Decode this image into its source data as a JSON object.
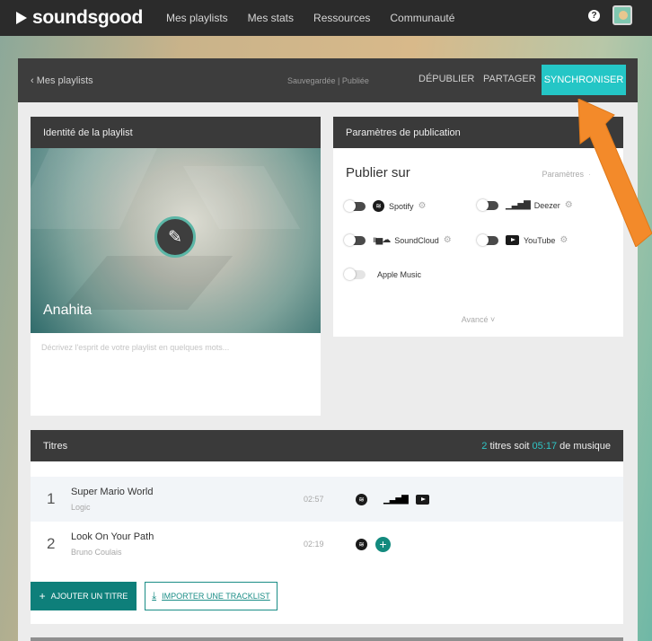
{
  "app": {
    "name": "soundsgood"
  },
  "nav": [
    "Mes playlists",
    "Mes stats",
    "Ressources",
    "Communauté"
  ],
  "header": {
    "back": "‹  Mes playlists",
    "status": "Sauvegardée | Publiée",
    "unpublish": "DÉPUBLIER",
    "share": "PARTAGER",
    "sync": "SYNCHRONISER"
  },
  "identity": {
    "title": "Identité de la playlist",
    "name": "Anahita",
    "description_placeholder": "Décrivez l'esprit de votre playlist en quelques mots..."
  },
  "publication": {
    "title": "Paramètres de publication",
    "heading": "Publier sur",
    "params": "Paramètres",
    "params_sep": "·",
    "services": [
      {
        "name": "Spotify",
        "icon": "spotify-icon"
      },
      {
        "name": "Deezer",
        "icon": "deezer-icon"
      },
      {
        "name": "SoundCloud",
        "icon": "soundcloud-icon"
      },
      {
        "name": "YouTube",
        "icon": "youtube-icon"
      },
      {
        "name": "Apple Music",
        "icon": "apple-icon"
      }
    ],
    "advanced": "Avancé  ˅"
  },
  "tracks": {
    "title": "Titres",
    "summary_count": "2",
    "summary_mid": " titres soit ",
    "summary_duration": "05:17",
    "summary_end": " de musique",
    "items": [
      {
        "index": "1",
        "title": "Super Mario World",
        "artist": "Logic",
        "duration": "02:57",
        "platforms": [
          "spotify-icon",
          "apple-icon",
          "deezer-icon",
          "youtube-icon"
        ]
      },
      {
        "index": "2",
        "title": "Look On Your Path",
        "artist": "Bruno Coulais",
        "duration": "02:19",
        "platforms": [
          "spotify-icon",
          "add-icon"
        ]
      }
    ],
    "add_button": "AJOUTER UN TITRE",
    "import_button": "IMPORTER UNE TRACKLIST"
  },
  "colors": {
    "accent": "#24c6c6",
    "primary_button": "#0e7f7a",
    "arrow": "#f38a2a"
  }
}
